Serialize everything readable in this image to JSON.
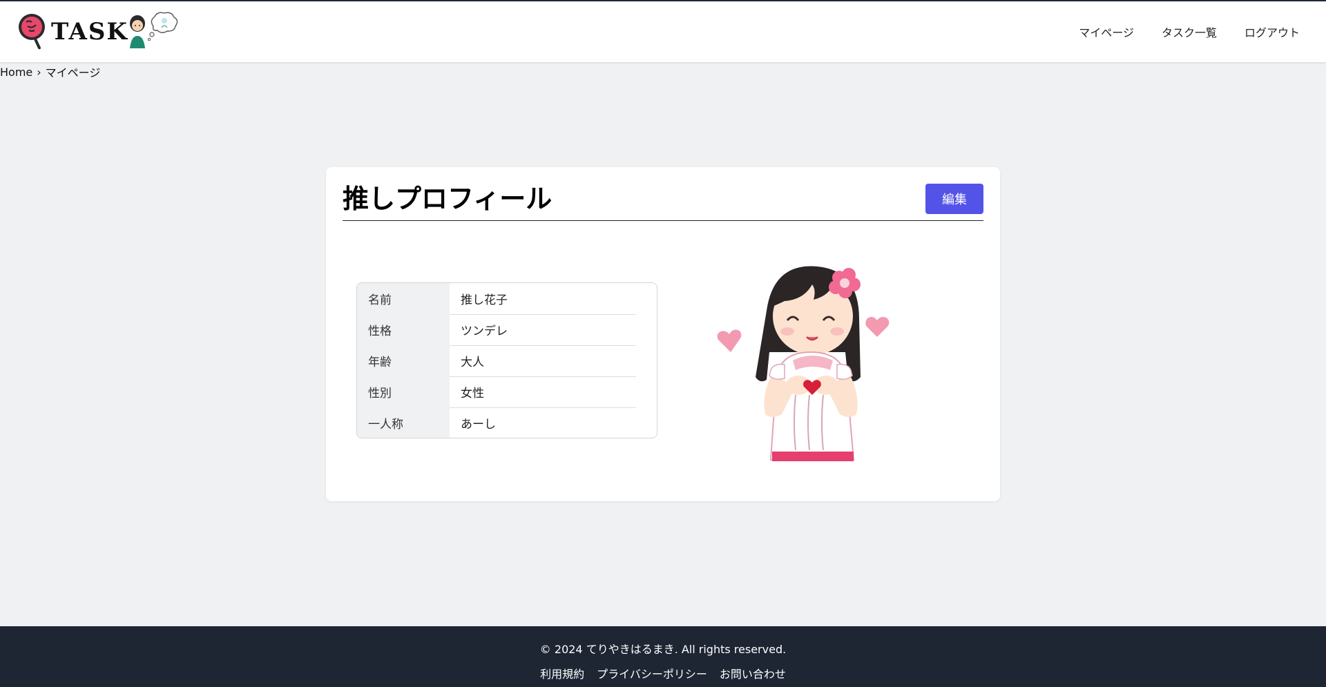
{
  "header": {
    "logo_text": "TASK",
    "nav": [
      {
        "label": "マイページ"
      },
      {
        "label": "タスク一覧"
      },
      {
        "label": "ログアウト"
      }
    ]
  },
  "breadcrumb": {
    "home": "Home",
    "separator": "›",
    "current": "マイページ"
  },
  "profile": {
    "title": "推しプロフィール",
    "edit_label": "編集",
    "rows": [
      {
        "key": "名前",
        "value": "推し花子"
      },
      {
        "key": "性格",
        "value": "ツンデレ"
      },
      {
        "key": "年齢",
        "value": "大人"
      },
      {
        "key": "性別",
        "value": "女性"
      },
      {
        "key": "一人称",
        "value": "あーし"
      }
    ]
  },
  "footer": {
    "copyright": "© 2024 てりやきはるまき. All rights reserved.",
    "links": [
      {
        "label": "利用規約"
      },
      {
        "label": "プライバシーポリシー"
      },
      {
        "label": "お問い合わせ"
      }
    ]
  },
  "colors": {
    "accent": "#5353e8",
    "footer_bg": "#1e2533",
    "page_bg": "#f0f1f3"
  }
}
